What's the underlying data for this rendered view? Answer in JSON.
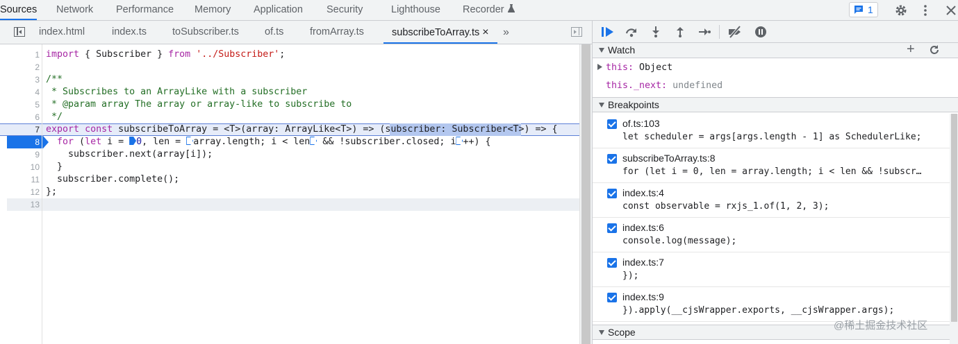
{
  "top_tabs": [
    "Sources",
    "Network",
    "Performance",
    "Memory",
    "Application",
    "Security",
    "Lighthouse",
    "Recorder"
  ],
  "issues_count": "1",
  "file_tabs": [
    "index.html",
    "index.ts",
    "toSubscriber.ts",
    "of.ts",
    "fromArray.ts",
    "subscribeToArray.ts"
  ],
  "active_file_close": "×",
  "more_tabs": "»",
  "editor": {
    "line_numbers": [
      "1",
      "2",
      "3",
      "4",
      "5",
      "6",
      "7",
      "8",
      "9",
      "10",
      "11",
      "12",
      "13"
    ],
    "paused_line": "8"
  },
  "watch": {
    "title": "Watch",
    "items": [
      {
        "expr": "this: ",
        "value": "Object"
      },
      {
        "expr": "this._next: ",
        "value": "undefined"
      }
    ]
  },
  "breakpoints": {
    "title": "Breakpoints",
    "items": [
      {
        "loc": "of.ts:103",
        "src": "let scheduler = args[args.length - 1] as SchedulerLike;"
      },
      {
        "loc": "subscribeToArray.ts:8",
        "src": "for (let i = 0, len = array.length; i < len && !subscr…"
      },
      {
        "loc": "index.ts:4",
        "src": "const observable = rxjs_1.of(1, 2, 3);"
      },
      {
        "loc": "index.ts:6",
        "src": "console.log(message);"
      },
      {
        "loc": "index.ts:7",
        "src": "});"
      },
      {
        "loc": "index.ts:9",
        "src": "}).apply(__cjsWrapper.exports, __cjsWrapper.args);"
      }
    ]
  },
  "scope": {
    "title": "Scope"
  },
  "watermark": "@稀土掘金技术社区"
}
